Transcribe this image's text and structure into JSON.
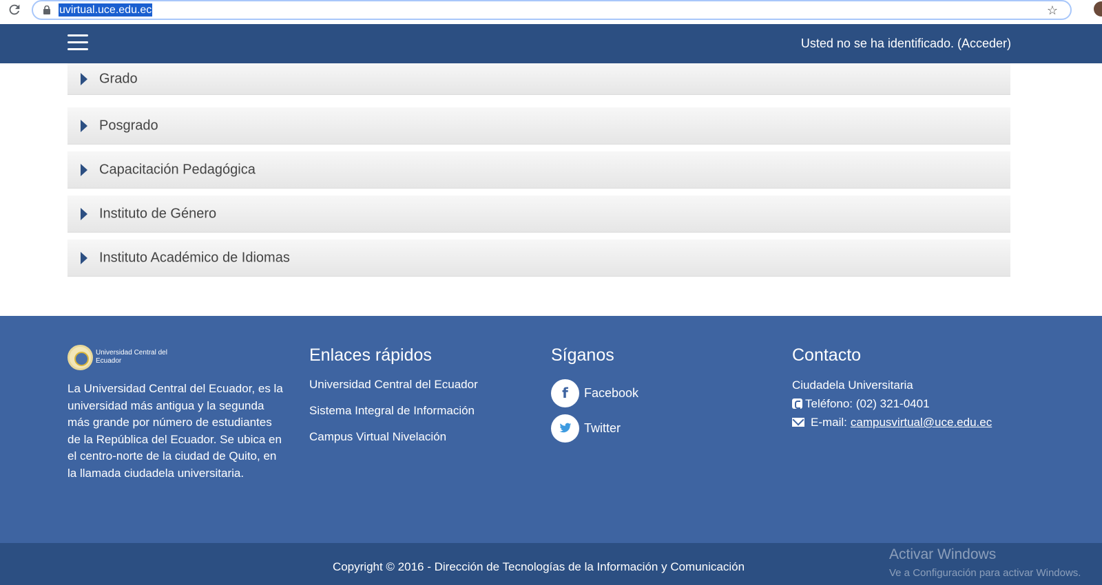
{
  "browser": {
    "url": "uvirtual.uce.edu.ec"
  },
  "navbar": {
    "login_text": "Usted no se ha identificado. (Acceder)"
  },
  "categories": [
    {
      "label": "Grado"
    },
    {
      "label": "Posgrado"
    },
    {
      "label": "Capacitación Pedagógica"
    },
    {
      "label": "Instituto de Género"
    },
    {
      "label": "Instituto Académico de Idiomas"
    }
  ],
  "footer": {
    "logo_text": "Universidad Central del Ecuador",
    "about": "La Universidad Central del Ecuador, es la universidad más antigua y la segunda más grande por número de estudiantes de la República del Ecuador. Se ubica en el centro-norte de la ciudad de Quito, en la llamada ciudadela universitaria.",
    "quick_links": {
      "title": "Enlaces rápidos",
      "items": [
        "Universidad Central del Ecuador",
        "Sistema Integral de Información",
        "Campus Virtual Nivelación"
      ]
    },
    "follow": {
      "title": "Síganos",
      "items": [
        {
          "label": "Facebook",
          "icon": "facebook-icon"
        },
        {
          "label": "Twitter",
          "icon": "twitter-icon"
        }
      ]
    },
    "contact": {
      "title": "Contacto",
      "address": "Ciudadela Universitaria",
      "phone": "Teléfono: (02) 321-0401",
      "email_label": "E-mail:",
      "email": "campusvirtual@uce.edu.ec"
    },
    "copyright": "Copyright © 2016 - Dirección de Tecnologías de la Información y Comunicación"
  },
  "watermark": {
    "title": "Activar Windows",
    "subtitle": "Ve a Configuración para activar Windows."
  },
  "colors": {
    "navbar": "#2c4f82",
    "footer": "#3e64a1",
    "copyright_bar": "#2c4f82"
  }
}
